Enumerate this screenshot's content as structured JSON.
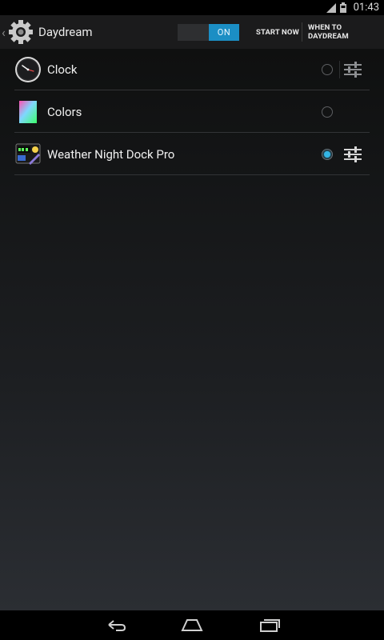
{
  "status_bar": {
    "time": "01:43"
  },
  "action_bar": {
    "title": "Daydream",
    "toggle_label": "ON",
    "start_now": "START NOW",
    "when_to_daydream": "WHEN TO DAYDREAM"
  },
  "dreams": [
    {
      "label": "Clock",
      "selected": false,
      "has_settings": true
    },
    {
      "label": "Colors",
      "selected": false,
      "has_settings": false
    },
    {
      "label": "Weather Night Dock Pro",
      "selected": true,
      "has_settings": true
    }
  ],
  "colors": {
    "accent": "#33b5e5",
    "toggle_on": "#1b8ec4",
    "divider": "#323436"
  }
}
